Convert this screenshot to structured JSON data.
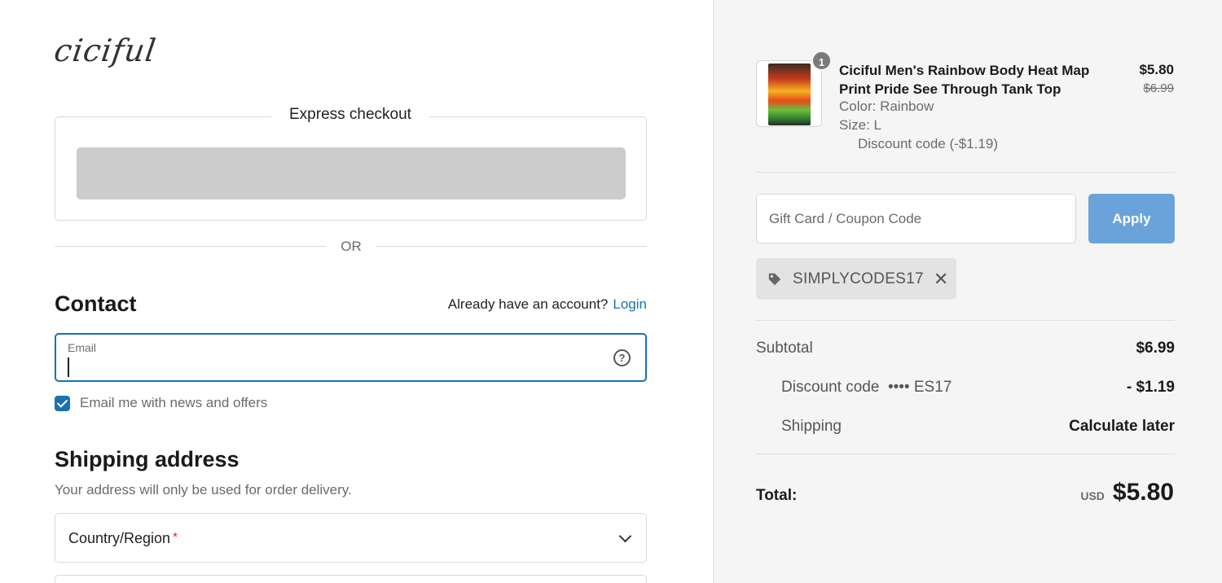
{
  "brand": {
    "logo_text": "ciciful"
  },
  "express": {
    "title": "Express checkout"
  },
  "divider": {
    "or_label": "OR"
  },
  "contact": {
    "heading": "Contact",
    "account_prompt": "Already have an account?",
    "login_label": "Login",
    "email_label": "Email",
    "email_value": "",
    "newsletter_label": "Email me with news and offers",
    "newsletter_checked": true
  },
  "shipping": {
    "heading": "Shipping address",
    "subtext": "Your address will only be used for order delivery.",
    "country_label": "Country/Region",
    "required_mark": "*"
  },
  "order": {
    "item": {
      "quantity": "1",
      "title": "Ciciful Men's Rainbow Body Heat Map Print Pride See Through Tank Top",
      "color": "Color: Rainbow",
      "size": "Size: L",
      "discount": "Discount code (-$1.19)",
      "price": "$5.80",
      "original_price": "$6.99"
    },
    "coupon": {
      "placeholder": "Gift Card / Coupon Code",
      "apply_label": "Apply",
      "applied_code": "SIMPLYCODES17"
    },
    "summary": {
      "subtotal_label": "Subtotal",
      "subtotal_value": "$6.99",
      "discount_label": "Discount code",
      "discount_code": "•••• ES17",
      "discount_value": "- $1.19",
      "shipping_label": "Shipping",
      "shipping_value": "Calculate later",
      "total_label": "Total:",
      "currency": "USD",
      "total_value": "$5.80"
    }
  },
  "colors": {
    "accent": "#1773b0",
    "apply_button": "#6aa3da",
    "sidebar_bg": "#f5f5f5",
    "express_placeholder": "#cccccc"
  }
}
